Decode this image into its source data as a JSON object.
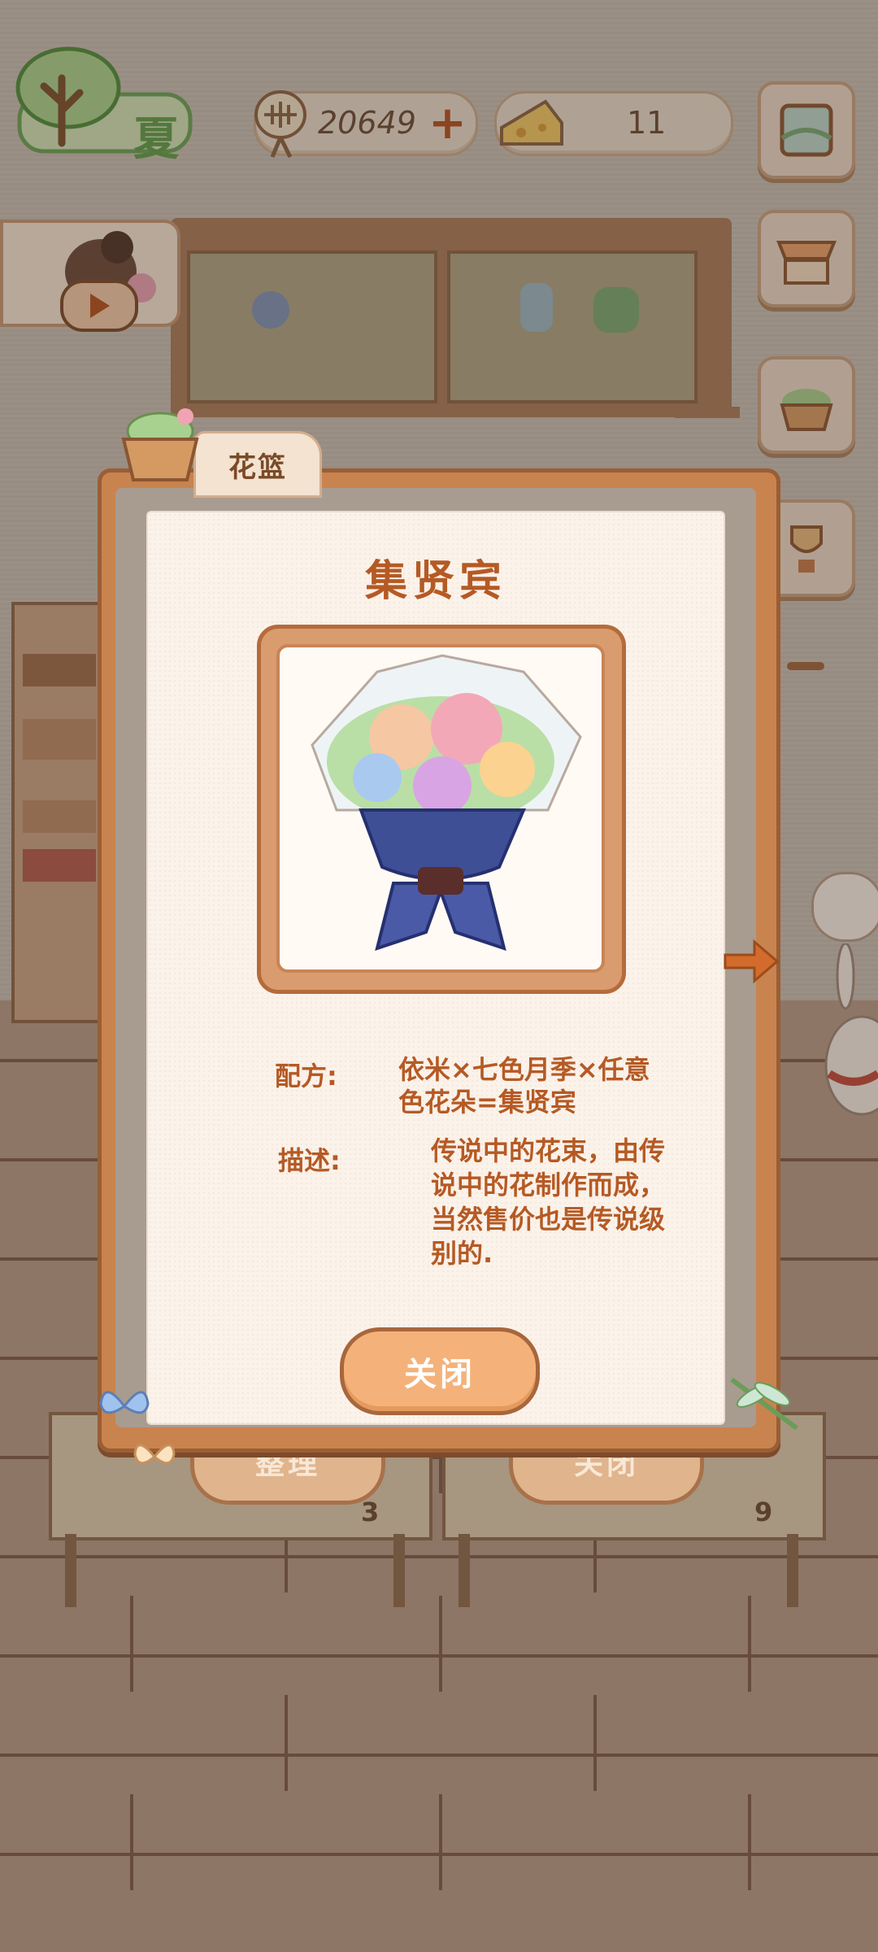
{
  "hud": {
    "season": "夏",
    "coins": "20649",
    "cheese": "11"
  },
  "dialog": {
    "tab_label": "花篮",
    "title": "集贤宾",
    "recipe_label": "配方:",
    "recipe_line1": "依米×七色月季×任意",
    "recipe_line2": "色花朵=集贤宾",
    "description_label": "描述:",
    "description_lines": [
      "传说中的花束，由传",
      "说中的花制作而成，",
      "当然售价也是传说级",
      "别的."
    ],
    "close_label": "关闭"
  },
  "bottom_buttons": {
    "organize_label": "整理",
    "close_label": "关闭"
  },
  "tables": {
    "left_count": "3",
    "right_count": "9"
  },
  "colors": {
    "accent_orange": "#b55a24",
    "frame_brown": "#c9834f",
    "paper": "#fbf2ea"
  }
}
